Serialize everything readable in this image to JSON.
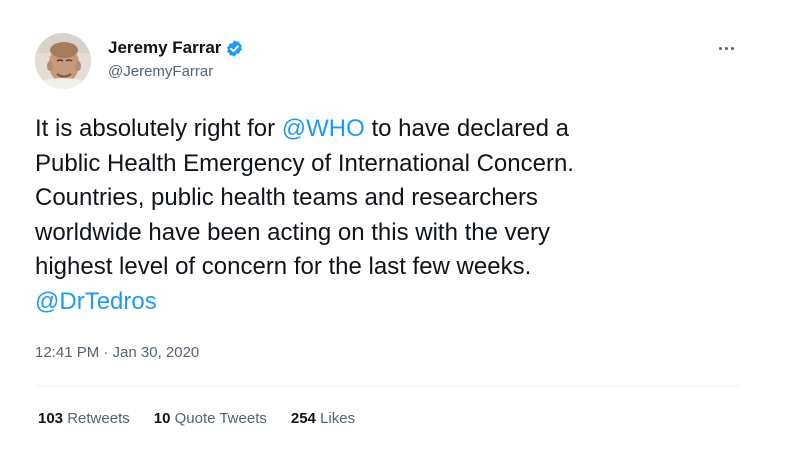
{
  "author": {
    "name": "Jeremy Farrar",
    "handle": "@JeremyFarrar",
    "verified_icon": "verified-badge-icon",
    "avatar_icon": "avatar"
  },
  "menu": {
    "icon": "more-options-icon"
  },
  "tweet": {
    "line1_pre": "It is absolutely right for ",
    "line1_mention": "@WHO",
    "line1_post": " to have declared a",
    "line2": "Public Health Emergency of International Concern.",
    "line3": "Countries, public health teams and researchers",
    "line4": "worldwide have been acting on this with the very",
    "line5": "highest level of concern for the last few weeks.",
    "line6_mention": "@DrTedros"
  },
  "timestamp": "12:41 PM · Jan 30, 2020",
  "stats": {
    "retweets_count": "103",
    "retweets_label": "Retweets",
    "quotes_count": "10",
    "quotes_label": "Quote Tweets",
    "likes_count": "254",
    "likes_label": "Likes"
  },
  "colors": {
    "accent": "#1d9bf0",
    "text": "#0f1419",
    "secondary": "#536471",
    "divider": "#eff3f4"
  }
}
